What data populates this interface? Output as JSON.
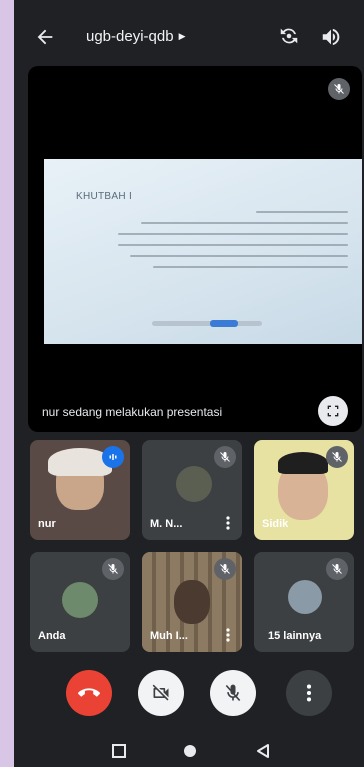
{
  "meeting": {
    "code": "ugb-deyi-qdb"
  },
  "presentation": {
    "slide_title": "KHUTBAH I",
    "status_text": "nur sedang melakukan presentasi"
  },
  "participants": [
    {
      "name": "nur",
      "state": "speaking"
    },
    {
      "name": "M. N...",
      "state": "muted"
    },
    {
      "name": "Sidik",
      "state": "muted"
    },
    {
      "name": "Anda",
      "state": "muted"
    },
    {
      "name": "Muh I...",
      "state": "muted"
    },
    {
      "name": "15 lainnya",
      "state": "muted"
    }
  ],
  "controls": {
    "end_call_color": "#ea4335",
    "camera": "off",
    "microphone": "off"
  },
  "icons": [
    "back-arrow-icon",
    "switch-camera-icon",
    "speaker-icon",
    "mic-off-icon",
    "fullscreen-icon",
    "hangup-icon",
    "camera-off-icon",
    "more-vertical-icon",
    "square-icon",
    "circle-icon",
    "triangle-icon"
  ]
}
